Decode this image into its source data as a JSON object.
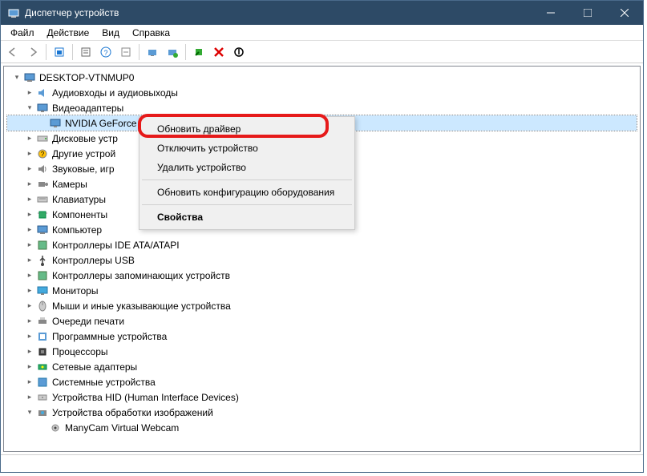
{
  "titlebar": {
    "title": "Диспетчер устройств"
  },
  "menus": {
    "file": "Файл",
    "action": "Действие",
    "view": "Вид",
    "help": "Справка"
  },
  "tree": {
    "root": "DESKTOP-VTNMUP0",
    "items": [
      {
        "label": "Аудиовходы и аудиовыходы",
        "exp": false
      },
      {
        "label": "Видеоадаптеры",
        "exp": true,
        "children": [
          {
            "label": "NVIDIA GeForce GTX 1050 Ti",
            "sel": true
          }
        ]
      },
      {
        "label": "Дисковые устр",
        "exp": false
      },
      {
        "label": "Другие устрой",
        "exp": false
      },
      {
        "label": "Звуковые, игр",
        "exp": false
      },
      {
        "label": "Камеры",
        "exp": false
      },
      {
        "label": "Клавиатуры",
        "exp": false
      },
      {
        "label": "Компоненты",
        "exp": false
      },
      {
        "label": "Компьютер",
        "exp": false
      },
      {
        "label": "Контроллеры IDE ATA/ATAPI",
        "exp": false
      },
      {
        "label": "Контроллеры USB",
        "exp": false
      },
      {
        "label": "Контроллеры запоминающих устройств",
        "exp": false
      },
      {
        "label": "Мониторы",
        "exp": false
      },
      {
        "label": "Мыши и иные указывающие устройства",
        "exp": false
      },
      {
        "label": "Очереди печати",
        "exp": false
      },
      {
        "label": "Программные устройства",
        "exp": false
      },
      {
        "label": "Процессоры",
        "exp": false
      },
      {
        "label": "Сетевые адаптеры",
        "exp": false
      },
      {
        "label": "Системные устройства",
        "exp": false
      },
      {
        "label": "Устройства HID (Human Interface Devices)",
        "exp": false
      },
      {
        "label": "Устройства обработки изображений",
        "exp": true,
        "children": [
          {
            "label": "ManyCam Virtual Webcam"
          }
        ]
      }
    ]
  },
  "context": {
    "update": "Обновить драйвер",
    "disable": "Отключить устройство",
    "remove": "Удалить устройство",
    "rescan": "Обновить конфигурацию оборудования",
    "props": "Свойства"
  }
}
